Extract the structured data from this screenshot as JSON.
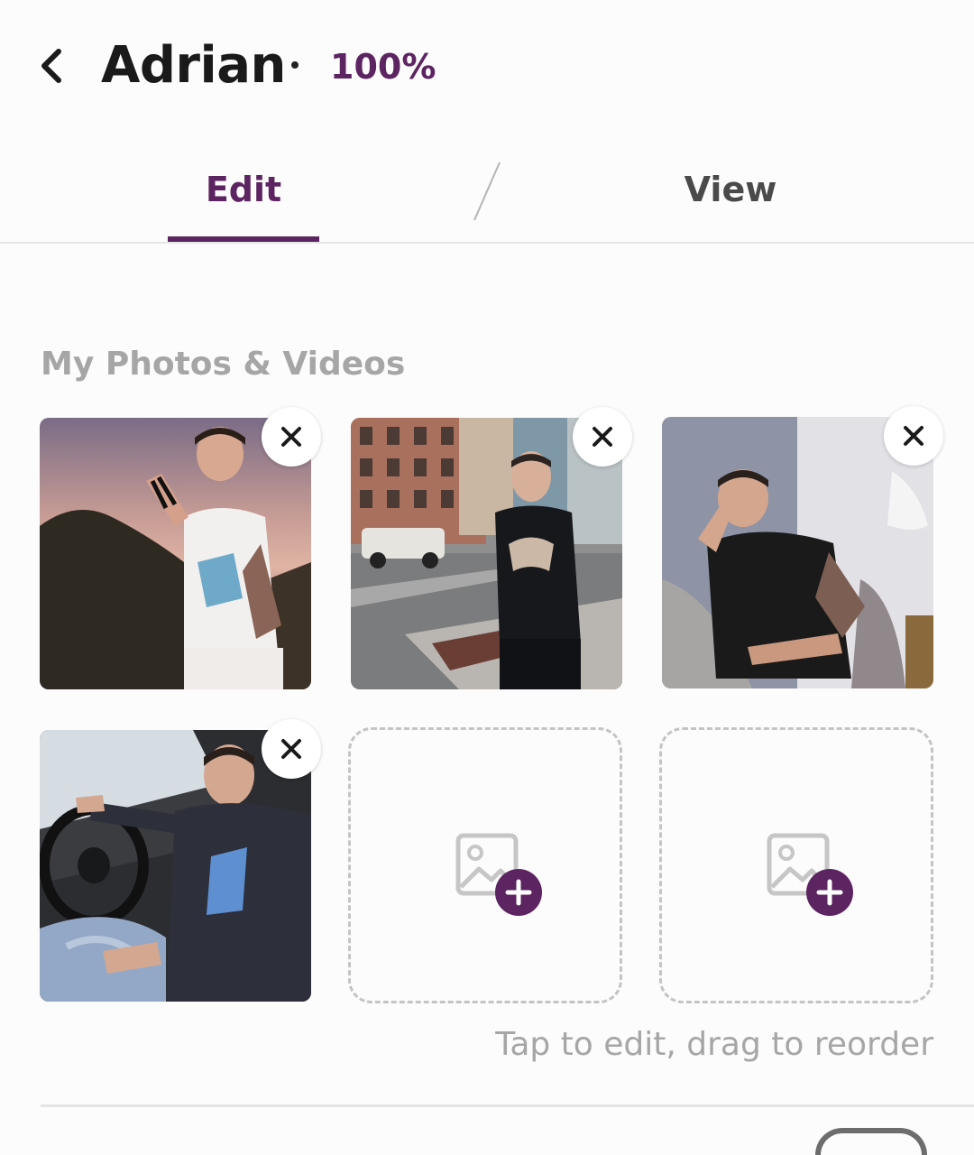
{
  "header": {
    "name": "Adrian",
    "completion": "100%",
    "back_icon": "chevron-left-icon"
  },
  "tabs": [
    {
      "label": "Edit",
      "active": true
    },
    {
      "label": "View",
      "active": false
    }
  ],
  "section": {
    "title": "My Photos & Videos",
    "hint": "Tap to edit, drag to reorder"
  },
  "photos": [
    {
      "description": "photo-1",
      "has_remove": true
    },
    {
      "description": "photo-2",
      "has_remove": true
    },
    {
      "description": "photo-3",
      "has_remove": true
    },
    {
      "description": "photo-4",
      "has_remove": true
    }
  ],
  "empty_slots": 2,
  "icons": {
    "remove": "close-icon",
    "add_media": "add-photo-icon"
  },
  "colors": {
    "accent": "#5c2461",
    "muted_text": "#a6a6a6",
    "tab_inactive": "#4a4a4a"
  }
}
